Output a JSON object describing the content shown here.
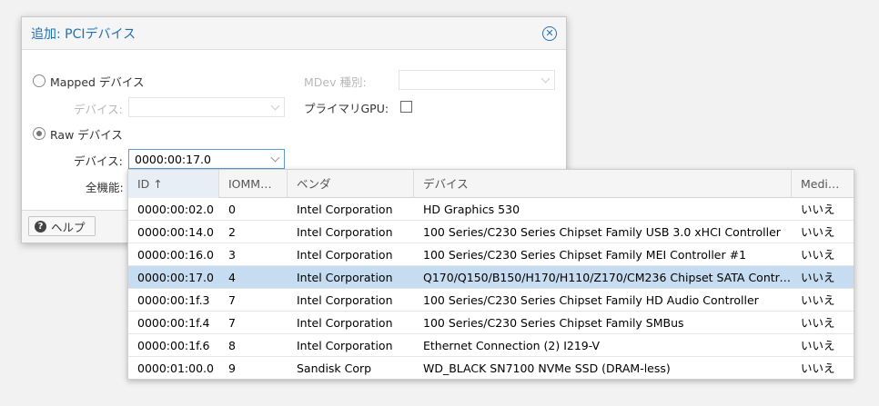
{
  "dialog": {
    "title": "追加: PCIデバイス",
    "mapped_label": "Mapped デバイス",
    "mapped_device_label": "デバイス:",
    "mdev_label": "MDev 種別:",
    "primary_gpu_label": "プライマリGPU:",
    "raw_label": "Raw デバイス",
    "raw_device_label": "デバイス:",
    "raw_device_value": "0000:00:17.0",
    "all_functions_label": "全機能:",
    "help_label": "ヘルプ"
  },
  "grid": {
    "columns": [
      "ID",
      "IOMM…",
      "ベンダ",
      "デバイス",
      "Medi…"
    ],
    "rows": [
      {
        "id": "0000:00:02.0",
        "iommu": "0",
        "vendor": "Intel Corporation",
        "device": "HD Graphics 530",
        "mdev": "いいえ"
      },
      {
        "id": "0000:00:14.0",
        "iommu": "2",
        "vendor": "Intel Corporation",
        "device": "100 Series/C230 Series Chipset Family USB 3.0 xHCI Controller",
        "mdev": "いいえ"
      },
      {
        "id": "0000:00:16.0",
        "iommu": "3",
        "vendor": "Intel Corporation",
        "device": "100 Series/C230 Series Chipset Family MEI Controller #1",
        "mdev": "いいえ"
      },
      {
        "id": "0000:00:17.0",
        "iommu": "4",
        "vendor": "Intel Corporation",
        "device": "Q170/Q150/B150/H170/H110/Z170/CM236 Chipset SATA Controll…",
        "mdev": "いいえ"
      },
      {
        "id": "0000:00:1f.3",
        "iommu": "7",
        "vendor": "Intel Corporation",
        "device": "100 Series/C230 Series Chipset Family HD Audio Controller",
        "mdev": "いいえ"
      },
      {
        "id": "0000:00:1f.4",
        "iommu": "7",
        "vendor": "Intel Corporation",
        "device": "100 Series/C230 Series Chipset Family SMBus",
        "mdev": "いいえ"
      },
      {
        "id": "0000:00:1f.6",
        "iommu": "8",
        "vendor": "Intel Corporation",
        "device": "Ethernet Connection (2) I219-V",
        "mdev": "いいえ"
      },
      {
        "id": "0000:01:00.0",
        "iommu": "9",
        "vendor": "Sandisk Corp",
        "device": "WD_BLACK SN7100 NVMe SSD (DRAM-less)",
        "mdev": "いいえ"
      }
    ]
  },
  "colors": {
    "accent": "#1f6fb5",
    "selected_row": "#c6dcf0"
  }
}
